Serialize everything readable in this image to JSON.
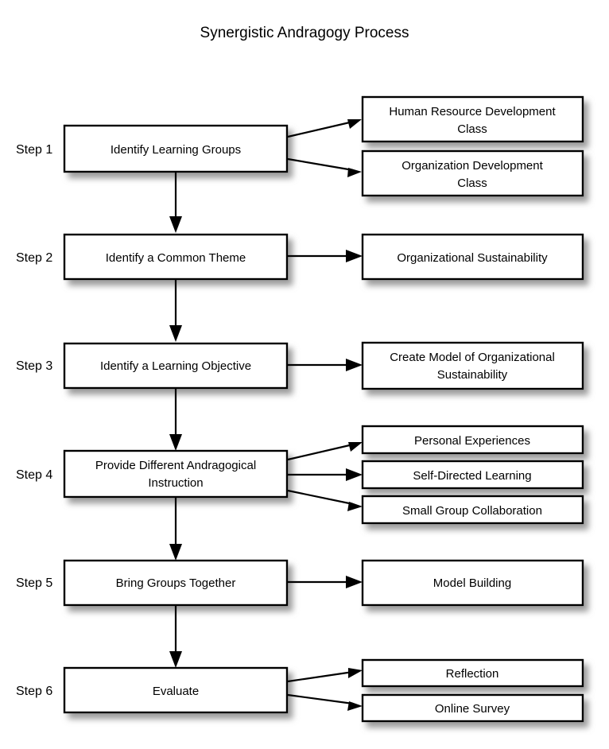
{
  "title": "Synergistic Andragogy Process",
  "steps": [
    {
      "step_label": "Step 1",
      "process": "Identify Learning Groups",
      "outputs": [
        "Human Resource Development Class",
        "Organization Development Class"
      ]
    },
    {
      "step_label": "Step 2",
      "process": "Identify a Common Theme",
      "outputs": [
        "Organizational Sustainability"
      ]
    },
    {
      "step_label": "Step 3",
      "process": "Identify a Learning Objective",
      "outputs": [
        "Create Model of Organizational Sustainability"
      ]
    },
    {
      "step_label": "Step 4",
      "process": "Provide Different Andragogical Instruction",
      "outputs": [
        "Personal Experiences",
        "Self-Directed Learning",
        "Small Group Collaboration"
      ]
    },
    {
      "step_label": "Step 5",
      "process": "Bring Groups Together",
      "outputs": [
        "Model Building"
      ]
    },
    {
      "step_label": "Step 6",
      "process": "Evaluate",
      "outputs": [
        "Reflection",
        "Online Survey"
      ]
    }
  ],
  "text_lines": {
    "s1_process": [
      "Identify Learning Groups"
    ],
    "s1_out0": [
      "Human Resource Development",
      "Class"
    ],
    "s1_out1": [
      "Organization Development",
      "Class"
    ],
    "s2_process": [
      "Identify a Common Theme"
    ],
    "s2_out0": [
      "Organizational Sustainability"
    ],
    "s3_process": [
      "Identify a Learning Objective"
    ],
    "s3_out0": [
      "Create Model of Organizational",
      "Sustainability"
    ],
    "s4_process": [
      "Provide Different Andragogical",
      "Instruction"
    ],
    "s4_out0": [
      "Personal Experiences"
    ],
    "s4_out1": [
      "Self-Directed Learning"
    ],
    "s4_out2": [
      "Small Group Collaboration"
    ],
    "s5_process": [
      "Bring Groups Together"
    ],
    "s5_out0": [
      "Model Building"
    ],
    "s6_process": [
      "Evaluate"
    ],
    "s6_out0": [
      "Reflection"
    ],
    "s6_out1": [
      "Online Survey"
    ]
  },
  "colors": {
    "background": "#ffffff",
    "box_fill": "#ffffff",
    "box_stroke": "#000000",
    "text": "#000000",
    "shadow": "#b0b0b0"
  }
}
